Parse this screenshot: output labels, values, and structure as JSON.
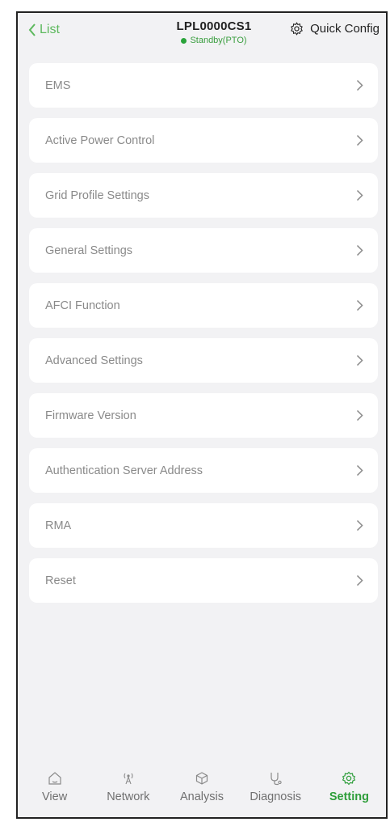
{
  "header": {
    "back_label": "List",
    "title": "LPL0000CS1",
    "status": "Standby(PTO)",
    "quick_config_label": "Quick Config"
  },
  "menu": {
    "items": [
      {
        "label": "EMS"
      },
      {
        "label": "Active Power Control"
      },
      {
        "label": "Grid Profile Settings"
      },
      {
        "label": "General Settings"
      },
      {
        "label": "AFCI Function"
      },
      {
        "label": "Advanced Settings"
      },
      {
        "label": "Firmware Version"
      },
      {
        "label": "Authentication Server Address"
      },
      {
        "label": "RMA"
      },
      {
        "label": "Reset"
      }
    ]
  },
  "nav": {
    "items": [
      {
        "label": "View",
        "icon": "home-icon"
      },
      {
        "label": "Network",
        "icon": "antenna-icon"
      },
      {
        "label": "Analysis",
        "icon": "cube-icon"
      },
      {
        "label": "Diagnosis",
        "icon": "stethoscope-icon"
      },
      {
        "label": "Setting",
        "icon": "gear-icon"
      }
    ],
    "active": "Setting"
  },
  "colors": {
    "accent": "#5cb85c",
    "active_nav": "#2e9e3a",
    "background": "#f2f2f4",
    "card": "#ffffff"
  }
}
